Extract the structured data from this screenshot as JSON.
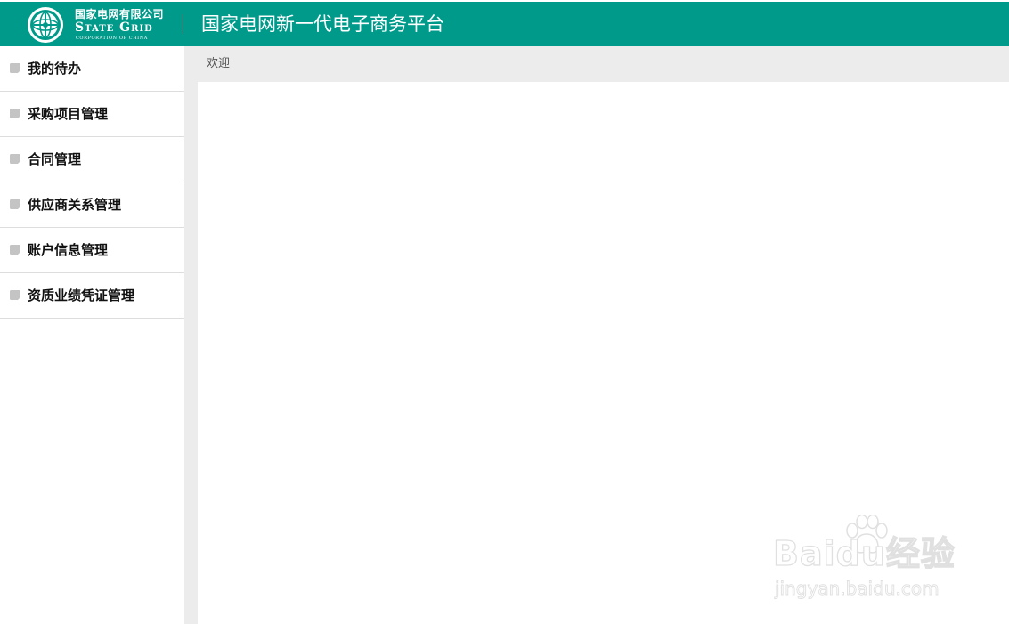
{
  "header": {
    "logo": {
      "name_cn": "国家电网有限公司",
      "name_en_1": "S",
      "name_en_2": "TATE",
      "name_en_3": "G",
      "name_en_4": "RID",
      "name_en_sub": "CORPORATION OF CHINA"
    },
    "platform_title": "国家电网新一代电子商务平台",
    "brand_color": "#009a8a"
  },
  "sidebar": {
    "items": [
      {
        "label": "我的待办",
        "icon": "folder-icon"
      },
      {
        "label": "采购项目管理",
        "icon": "folder-icon"
      },
      {
        "label": "合同管理",
        "icon": "folder-icon"
      },
      {
        "label": "供应商关系管理",
        "icon": "folder-icon"
      },
      {
        "label": "账户信息管理",
        "icon": "folder-icon"
      },
      {
        "label": "资质业绩凭证管理",
        "icon": "folder-icon"
      }
    ]
  },
  "tabs": {
    "active": "欢迎"
  },
  "watermark": {
    "brand": "Baidu经验",
    "url": "jingyan.baidu.com"
  }
}
